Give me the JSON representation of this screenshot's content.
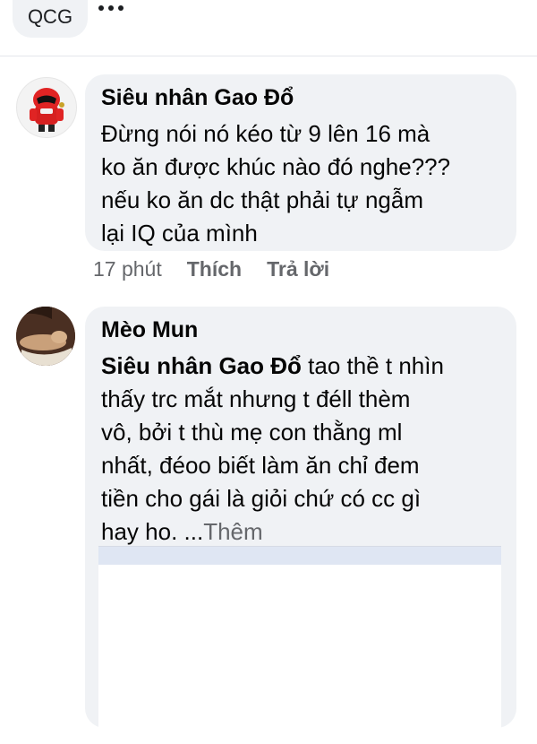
{
  "topbar": {
    "chip_label": "QCG",
    "more_icon": "more-dots-icon"
  },
  "comments": [
    {
      "author": "Siêu nhân Gao Đổ",
      "lines": [
        "Đừng nói nó kéo từ 9 lên 16 mà",
        "ko ăn được khúc nào đó nghe???",
        "nếu ko ăn dc thật phải tự ngẫm",
        "lại IQ của mình"
      ],
      "time": "17 phút",
      "like_label": "Thích",
      "reply_label": "Trả lời"
    },
    {
      "author": "Mèo Mun",
      "mention": "Siêu nhân Gao Đổ",
      "line1_rest": " tao thề t nhìn",
      "lines": [
        "thấy trc mắt nhưng t đéll thèm",
        "vô, bởi t thù mẹ con thằng ml",
        "nhất, đéoo biết làm ăn chỉ đem",
        "tiền cho gái là giỏi chứ có cc gì"
      ],
      "last_line": "hay ho. ...",
      "see_more": "Thêm"
    }
  ]
}
